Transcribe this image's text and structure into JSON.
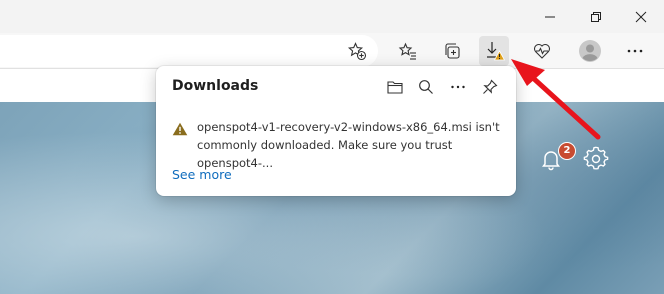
{
  "window_controls": {
    "minimize_icon": "minimize-icon",
    "restore_icon": "restore-icon",
    "close_icon": "close-icon"
  },
  "toolbar": {
    "icons": [
      "add-favorite-icon",
      "favorites-icon",
      "collections-icon",
      "downloads-icon",
      "browser-essentials-icon",
      "profile-avatar",
      "more-icon"
    ]
  },
  "downloads": {
    "title": "Downloads",
    "message": "openspot4-v1-recovery-v2-windows-x86_64.msi isn't commonly downloaded. Make sure you trust openspot4-...",
    "see_more": "See more"
  },
  "page": {
    "notification_count": "2"
  },
  "colors": {
    "accent_link": "#0f6cbd",
    "warning": "#8a6d1e",
    "badge": "#c84b31",
    "annotation_arrow": "#e8141c"
  }
}
